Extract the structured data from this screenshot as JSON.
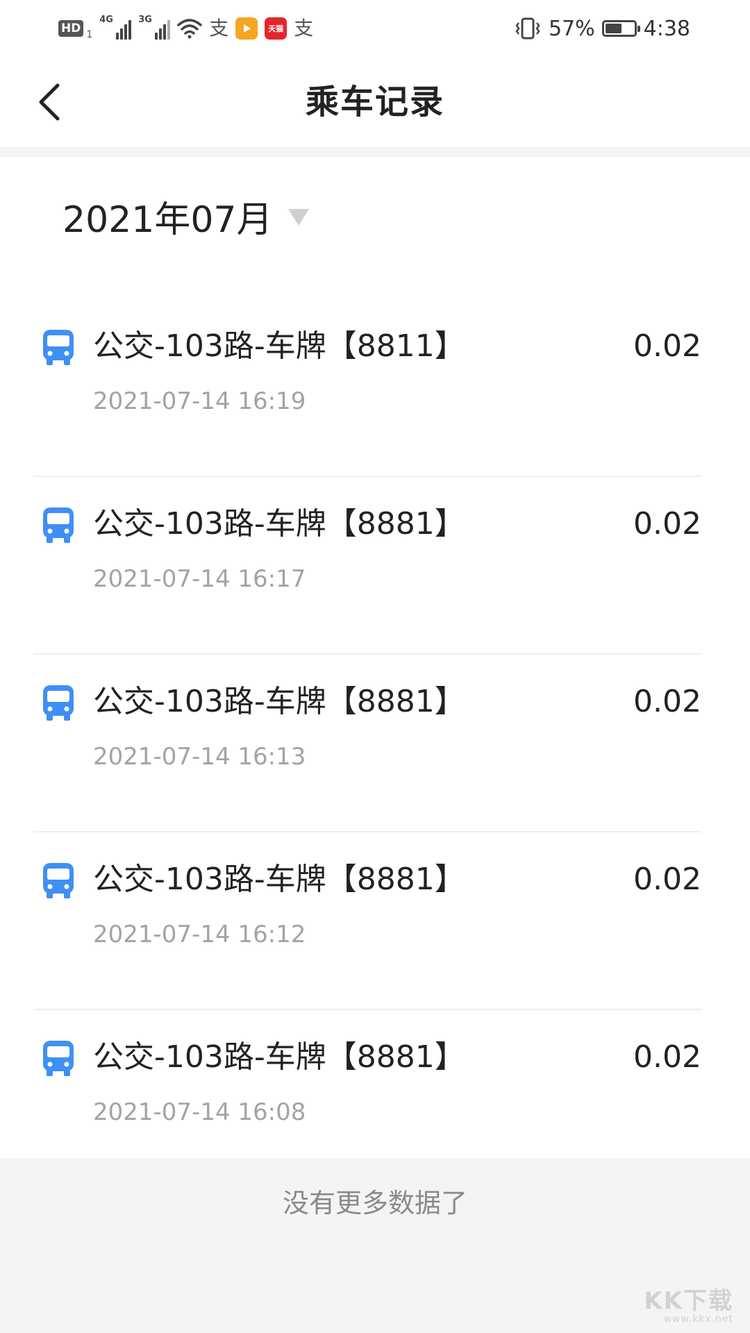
{
  "status_bar": {
    "hd_label": "HD",
    "hd_sub": "1",
    "net1_label": "4G",
    "net2_label": "3G",
    "app2_label": "天猫",
    "alipay_glyph": "支",
    "battery_percent": "57%",
    "battery_level": 0.57,
    "time": "4:38"
  },
  "header": {
    "title": "乘车记录",
    "back_icon": "chevron-left-icon"
  },
  "filter": {
    "month": "2021年07月"
  },
  "records": [
    {
      "title": "公交-103路-车牌【8811】",
      "time": "2021-07-14 16:19",
      "amount": "0.02"
    },
    {
      "title": "公交-103路-车牌【8881】",
      "time": "2021-07-14 16:17",
      "amount": "0.02"
    },
    {
      "title": "公交-103路-车牌【8881】",
      "time": "2021-07-14 16:13",
      "amount": "0.02"
    },
    {
      "title": "公交-103路-车牌【8881】",
      "time": "2021-07-14 16:12",
      "amount": "0.02"
    },
    {
      "title": "公交-103路-车牌【8881】",
      "time": "2021-07-14 16:08",
      "amount": "0.02"
    }
  ],
  "footer": {
    "no_more": "没有更多数据了"
  },
  "watermark": {
    "logo": "KK下载",
    "url": "www.kkx.net"
  },
  "colors": {
    "bus_icon": "#3f8ff5",
    "primary_text": "#222222",
    "secondary_text": "#a3a3a3",
    "page_bg": "#f4f4f4"
  }
}
